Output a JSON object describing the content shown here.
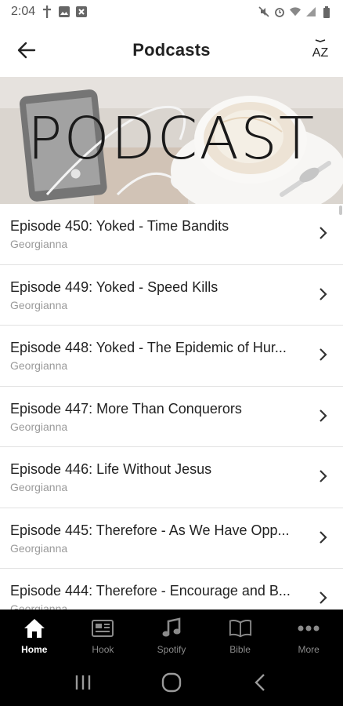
{
  "status_bar": {
    "time": "2:04",
    "left_icons": [
      "cross-icon",
      "image-icon",
      "x-box-icon"
    ],
    "right_icons": [
      "mute-icon",
      "alarm-icon",
      "wifi-icon",
      "signal-icon",
      "battery-icon"
    ]
  },
  "app_bar": {
    "title": "Podcasts",
    "back_icon": "arrow-left-icon",
    "sort_icon": "sort-az-icon",
    "sort_label": "AZ"
  },
  "hero": {
    "text": "PODCAST"
  },
  "episodes": [
    {
      "title": "Episode 450: Yoked - Time Bandits",
      "author": "Georgianna"
    },
    {
      "title": "Episode 449: Yoked - Speed Kills",
      "author": "Georgianna"
    },
    {
      "title": "Episode 448: Yoked - The Epidemic of Hur...",
      "author": "Georgianna"
    },
    {
      "title": "Episode 447: More Than Conquerors",
      "author": "Georgianna"
    },
    {
      "title": "Episode 446: Life Without Jesus",
      "author": "Georgianna"
    },
    {
      "title": "Episode 445: Therefore - As We Have Opp...",
      "author": "Georgianna"
    },
    {
      "title": "Episode 444: Therefore - Encourage and B...",
      "author": "Georgianna"
    }
  ],
  "bottom_nav": [
    {
      "label": "Home",
      "icon": "home-icon",
      "active": true
    },
    {
      "label": "Hook",
      "icon": "newspaper-icon",
      "active": false
    },
    {
      "label": "Spotify",
      "icon": "music-note-icon",
      "active": false
    },
    {
      "label": "Bible",
      "icon": "book-icon",
      "active": false
    },
    {
      "label": "More",
      "icon": "more-dots-icon",
      "active": false
    }
  ],
  "system_nav": [
    "recents-icon",
    "home-circle-icon",
    "back-chevron-icon"
  ],
  "colors": {
    "nav_background": "#000000",
    "active_label": "#ffffff",
    "inactive_label": "#8a8a8a",
    "subtitle": "#9a9a9a"
  }
}
